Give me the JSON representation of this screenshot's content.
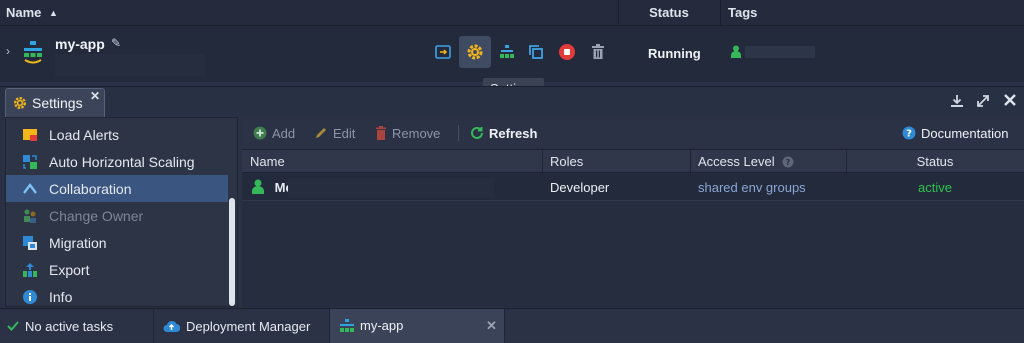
{
  "header": {
    "name_label": "Name",
    "sort_indicator": "▲",
    "status_label": "Status",
    "tags_label": "Tags"
  },
  "env": {
    "name": "my-app",
    "status": "Running",
    "tooltip": "Settings"
  },
  "panel": {
    "tab_label": "Settings",
    "menu": [
      {
        "label": "Load Alerts",
        "icon": "alert-icon"
      },
      {
        "label": "Auto Horizontal Scaling",
        "icon": "scaling-icon"
      },
      {
        "label": "Collaboration",
        "icon": "collaboration-icon",
        "selected": true
      },
      {
        "label": "Change Owner",
        "icon": "change-owner-icon",
        "disabled": true
      },
      {
        "label": "Migration",
        "icon": "migration-icon"
      },
      {
        "label": "Export",
        "icon": "export-icon"
      },
      {
        "label": "Info",
        "icon": "info-icon"
      }
    ]
  },
  "toolbar": {
    "add": "Add",
    "edit": "Edit",
    "remove": "Remove",
    "refresh": "Refresh",
    "documentation": "Documentation"
  },
  "table": {
    "columns": [
      "Name",
      "Roles",
      "Access Level",
      "Status"
    ],
    "rows": [
      {
        "name": "Me",
        "role": "Developer",
        "access": "shared env groups",
        "status": "active"
      }
    ]
  },
  "bottom": {
    "tasks": "No active tasks",
    "deployment_manager": "Deployment Manager",
    "env_tab": "my-app"
  },
  "colors": {
    "accent_blue": "#2f8ad6",
    "status_green": "#2ec24e",
    "gear_yellow": "#f2b619",
    "stop_red": "#e03c3c",
    "link_blue": "#8aa6d6"
  }
}
